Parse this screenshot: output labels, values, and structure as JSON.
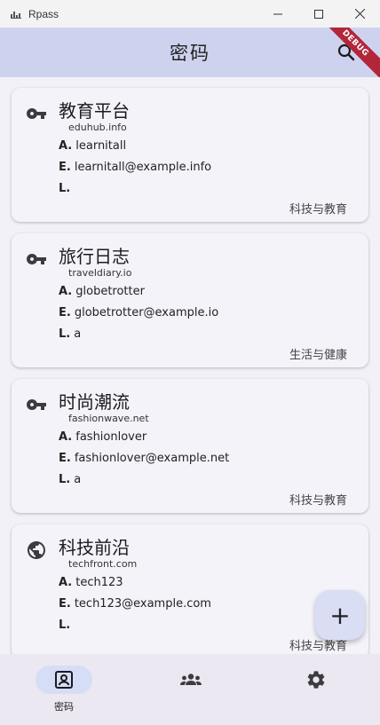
{
  "window": {
    "title": "Rpass",
    "minimize": "—",
    "maximize": "☐",
    "close": "✕"
  },
  "appbar": {
    "title": "密码",
    "debug_label": "DEBUG"
  },
  "entries": [
    {
      "icon": "key-icon",
      "title": "教育平台",
      "domain": "eduhub.info",
      "account": "learnitall",
      "email": "learnitall@example.info",
      "login": "",
      "category": "科技与教育"
    },
    {
      "icon": "key-icon",
      "title": "旅行日志",
      "domain": "traveldiary.io",
      "account": "globetrotter",
      "email": "globetrotter@example.io",
      "login": "a",
      "category": "生活与健康"
    },
    {
      "icon": "key-icon",
      "title": "时尚潮流",
      "domain": "fashionwave.net",
      "account": "fashionlover",
      "email": "fashionlover@example.net",
      "login": "a",
      "category": "科技与教育"
    },
    {
      "icon": "globe-icon",
      "title": "科技前沿",
      "domain": "techfront.com",
      "account": "tech123",
      "email": "tech123@example.com",
      "login": "",
      "category": "科技与教育"
    }
  ],
  "field_labels": {
    "account": "A.",
    "email": "E.",
    "login": "L."
  },
  "fab": {
    "label": "+"
  },
  "nav": {
    "passwords_label": "密码",
    "selected": "passwords"
  }
}
